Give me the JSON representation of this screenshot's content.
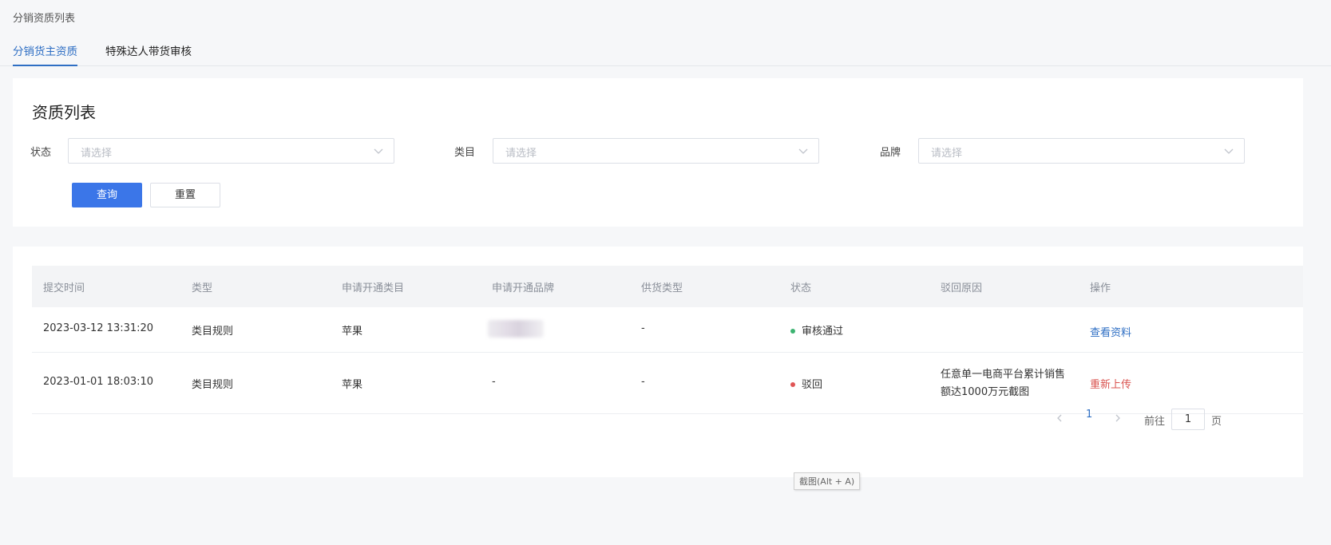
{
  "breadcrumb": "分销资质列表",
  "tabs": [
    {
      "label": "分销货主资质",
      "active": true
    },
    {
      "label": "特殊达人带货审核",
      "active": false
    }
  ],
  "filter": {
    "title": "资质列表",
    "fields": [
      {
        "label": "状态",
        "placeholder": "请选择"
      },
      {
        "label": "类目",
        "placeholder": "请选择"
      },
      {
        "label": "品牌",
        "placeholder": "请选择"
      }
    ],
    "query_label": "查询",
    "reset_label": "重置"
  },
  "table": {
    "columns": [
      "提交时间",
      "类型",
      "申请开通类目",
      "申请开通品牌",
      "供货类型",
      "状态",
      "驳回原因",
      "操作"
    ],
    "rows": [
      {
        "time": "2023-03-12 13:31:20",
        "type": "类目规则",
        "category": "苹果",
        "brand": "",
        "supply": "-",
        "status": "审核通过",
        "status_color": "#3cb371",
        "reason": "",
        "action": "查看资料",
        "action_color": "#2f6fc4"
      },
      {
        "time": "2023-01-01 18:03:10",
        "type": "类目规则",
        "category": "苹果",
        "brand": "-",
        "supply": "-",
        "status": "驳回",
        "status_color": "#e05555",
        "reason": "任意单一电商平台累计销售额达1000万元截图",
        "action": "重新上传",
        "action_color": "#d9534f"
      }
    ]
  },
  "pagination": {
    "current": "1",
    "goto_label": "前往",
    "goto_value": "1",
    "page_suffix": "页"
  },
  "tooltip": "截图(Alt + A)",
  "colors": {
    "primary": "#3b76e8",
    "tab_active": "#2f6fc4"
  }
}
